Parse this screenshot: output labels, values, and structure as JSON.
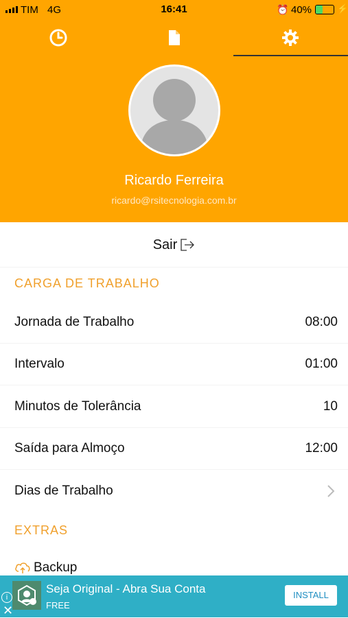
{
  "status_bar": {
    "carrier": "TIM",
    "network": "4G",
    "time": "16:41",
    "battery": "40%",
    "battery_level": 0.4
  },
  "tabs": [
    {
      "icon": "clock-icon"
    },
    {
      "icon": "document-icon"
    },
    {
      "icon": "gear-icon",
      "active": true
    }
  ],
  "profile": {
    "name": "Ricardo Ferreira",
    "email": "ricardo@rsitecnologia.com.br"
  },
  "logout": {
    "label": "Sair",
    "icon": "logout-icon"
  },
  "sections": {
    "workload": {
      "header": "CARGA DE TRABALHO",
      "rows": [
        {
          "label": "Jornada de Trabalho",
          "value": "08:00"
        },
        {
          "label": "Intervalo",
          "value": "01:00"
        },
        {
          "label": "Minutos de Tolerância",
          "value": "10"
        },
        {
          "label": "Saída para Almoço",
          "value": "12:00"
        },
        {
          "label": "Dias de Trabalho",
          "icon": "chevron-right-icon"
        }
      ]
    },
    "extras": {
      "header": "EXTRAS",
      "rows": [
        {
          "label": "Backup",
          "icon": "cloud-upload-icon"
        }
      ]
    }
  },
  "ad": {
    "title": "Seja Original - Abra Sua Conta",
    "subtitle": "FREE",
    "button": "INSTALL"
  },
  "colors": {
    "primary": "#FFA500",
    "section_header": "#F0A02C",
    "ad_background": "#2FAFC6"
  }
}
